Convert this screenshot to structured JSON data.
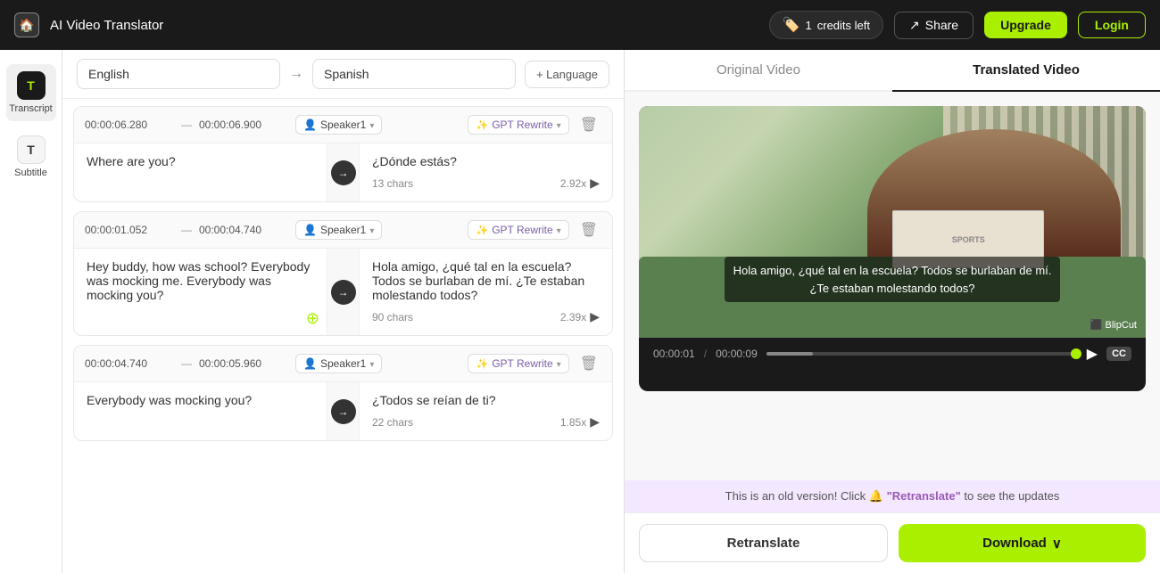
{
  "app": {
    "title": "AI Video Translator",
    "logo_icon": "🏠"
  },
  "navbar": {
    "credits_emoji": "🏷️",
    "credits_count": "1",
    "credits_label": "credits left",
    "share_label": "Share",
    "upgrade_label": "Upgrade",
    "login_label": "Login"
  },
  "sidebar": {
    "items": [
      {
        "id": "transcript",
        "label": "Transcript",
        "icon": "T",
        "active": true
      },
      {
        "id": "subtitle",
        "label": "Subtitle",
        "icon": "T",
        "active": false
      }
    ]
  },
  "language_bar": {
    "source_lang": "English",
    "arrow": "→",
    "target_lang": "Spanish",
    "add_label": "+ Language"
  },
  "segments": [
    {
      "id": 1,
      "time_start": "00:00:06.280",
      "time_dash": "—",
      "time_end": "00:00:06.900",
      "speaker": "Speaker1",
      "gpt_label": "GPT Rewrite",
      "source_text": "Where are you?",
      "target_text": "¿Dónde estás?",
      "chars": "13 chars",
      "speed": "2.92x"
    },
    {
      "id": 2,
      "time_start": "00:00:01.052",
      "time_dash": "—",
      "time_end": "00:00:04.740",
      "speaker": "Speaker1",
      "gpt_label": "GPT Rewrite",
      "source_text": "Hey buddy, how was school? Everybody was mocking me. Everybody was mocking you?",
      "target_text": "Hola amigo, ¿qué tal en la escuela? Todos se burlaban de mí. ¿Te estaban molestando todos?",
      "chars": "90 chars",
      "speed": "2.39x"
    },
    {
      "id": 3,
      "time_start": "00:00:04.740",
      "time_dash": "—",
      "time_end": "00:00:05.960",
      "speaker": "Speaker1",
      "gpt_label": "GPT Rewrite",
      "source_text": "Everybody was mocking you?",
      "target_text": "¿Todos se reían de ti?",
      "chars": "22 chars",
      "speed": "1.85x"
    }
  ],
  "video_panel": {
    "tab_original": "Original Video",
    "tab_translated": "Translated Video",
    "subtitle_line1": "Hola amigo, ¿qué tal en la escuela? Todos se burlaban de mí.",
    "subtitle_line2": "¿Te estaban molestando todos?",
    "watermark": "BlipCut",
    "time_current": "00:00:01",
    "time_total": "00:00:09",
    "cc_label": "CC",
    "update_banner": "This is an old version! Click",
    "retranslate_link": "\"Retranslate\"",
    "update_suffix": "to see the updates",
    "retranslate_btn": "Retranslate",
    "download_btn": "Download"
  }
}
